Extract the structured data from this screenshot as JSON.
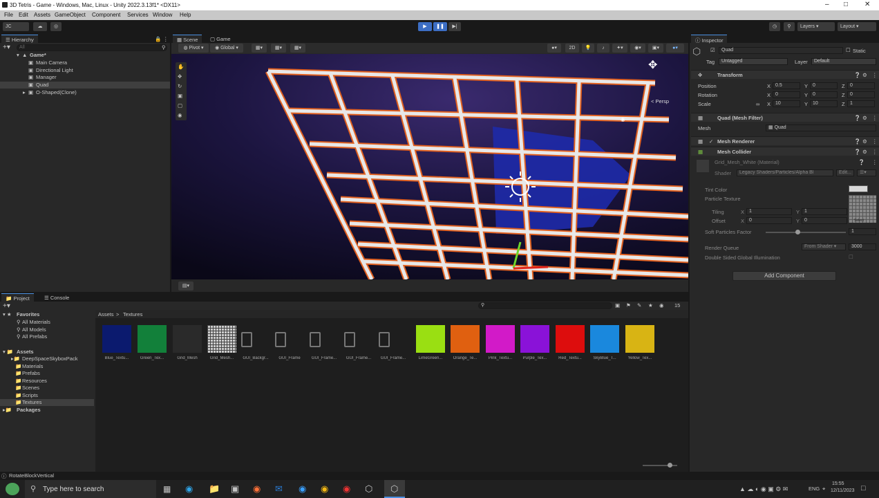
{
  "window": {
    "title": "3D Tetris - Game - Windows, Mac, Linux - Unity 2022.3.13f1* <DX11>"
  },
  "menu": [
    "File",
    "Edit",
    "Assets",
    "GameObject",
    "Component",
    "Services",
    "Window",
    "Help"
  ],
  "toolbar": {
    "account": "JC",
    "layers": "Layers",
    "layout": "Layout"
  },
  "hierarchy": {
    "tab": "Hierarchy",
    "search_placeholder": "All",
    "items": [
      {
        "label": "Game*"
      },
      {
        "label": "Main Camera"
      },
      {
        "label": "Directional Light"
      },
      {
        "label": "Manager"
      },
      {
        "label": "Quad"
      },
      {
        "label": "O-Shaped(Clone)"
      }
    ]
  },
  "scene": {
    "tabs": [
      "Scene",
      "Game"
    ],
    "pivot": "Pivot",
    "global": "Global",
    "mode2d": "2D",
    "persp": "< Persp"
  },
  "inspector": {
    "tab": "Inspector",
    "object_name": "Quad",
    "static": "Static",
    "tag_label": "Tag",
    "tag": "Untagged",
    "layer_label": "Layer",
    "layer": "Default",
    "transform": {
      "title": "Transform",
      "rows": [
        {
          "label": "Position",
          "x": "0.5",
          "y": "0",
          "z": "0"
        },
        {
          "label": "Rotation",
          "x": "0",
          "y": "0",
          "z": "0"
        },
        {
          "label": "Scale",
          "x": "10",
          "y": "10",
          "z": "1"
        }
      ]
    },
    "mesh_filter": {
      "title": "Quad (Mesh Filter)",
      "mesh_label": "Mesh",
      "mesh": "Quad"
    },
    "mesh_renderer": "Mesh Renderer",
    "mesh_collider": "Mesh Collider",
    "material": {
      "name": "Grid_Mesh_White (Material)",
      "shader_label": "Shader",
      "shader": "Legacy Shaders/Particles/Alpha Bl",
      "edit": "Edit...",
      "tint": "Tint Color",
      "particle_texture": "Particle Texture",
      "tiling": "Tiling",
      "offset": "Offset",
      "tiling_x": "1",
      "tiling_y": "1",
      "offset_x": "0",
      "offset_y": "0",
      "select": "Select",
      "soft_particles": "Soft Particles Factor",
      "soft_value": "1",
      "render_queue": "Render Queue",
      "from_shader": "From Shader",
      "queue_value": "3000",
      "double_sided": "Double Sided Global Illumination"
    },
    "add_component": "Add Component"
  },
  "project": {
    "tabs": [
      "Project",
      "Console"
    ],
    "favorites": "Favorites",
    "fav_items": [
      "All Materials",
      "All Models",
      "All Prefabs"
    ],
    "assets": "Assets",
    "asset_folders": [
      "DeepSpaceSkyboxPack",
      "Materials",
      "Prefabs",
      "Resources",
      "Scenes",
      "Scripts",
      "Textures"
    ],
    "packages": "Packages",
    "breadcrumb": [
      "Assets",
      "Textures"
    ],
    "count": "15",
    "textures": [
      {
        "label": "Blue_Textu...",
        "color": "#0b1a6e"
      },
      {
        "label": "Green_Tex...",
        "color": "#12803a"
      },
      {
        "label": "Grid_Mesh",
        "color": "#2a2a2a"
      },
      {
        "label": "Grid_Mesh...",
        "color": "#d8d8d8"
      },
      {
        "label": "GUI_Backgr...",
        "color": "#111111"
      },
      {
        "label": "GUI_Frame",
        "color": "#111111"
      },
      {
        "label": "GUI_Frame...",
        "color": "#111111"
      },
      {
        "label": "GUI_Frame...",
        "color": "#111111"
      },
      {
        "label": "GUI_Frame...",
        "color": "#222222"
      },
      {
        "label": "LimeGreen...",
        "color": "#9adf12"
      },
      {
        "label": "Orange_Te...",
        "color": "#e06010"
      },
      {
        "label": "Pink_Textu...",
        "color": "#d21ac8"
      },
      {
        "label": "Purple_Tex...",
        "color": "#8a12d8"
      },
      {
        "label": "Red_Textu...",
        "color": "#dd0d0d"
      },
      {
        "label": "SkyBlue_T...",
        "color": "#1a88dd"
      },
      {
        "label": "Yellow_Tex...",
        "color": "#d8b414"
      }
    ]
  },
  "status": {
    "text": "RotateBlockVertical"
  },
  "taskbar": {
    "search_placeholder": "Type here to search",
    "lang": "ENG",
    "time": "15:55",
    "date": "12/11/2023"
  },
  "colors": {
    "accent": "#4a90e2",
    "grid_outline": "#e06020",
    "grid_fill": "#e8e8e8"
  }
}
